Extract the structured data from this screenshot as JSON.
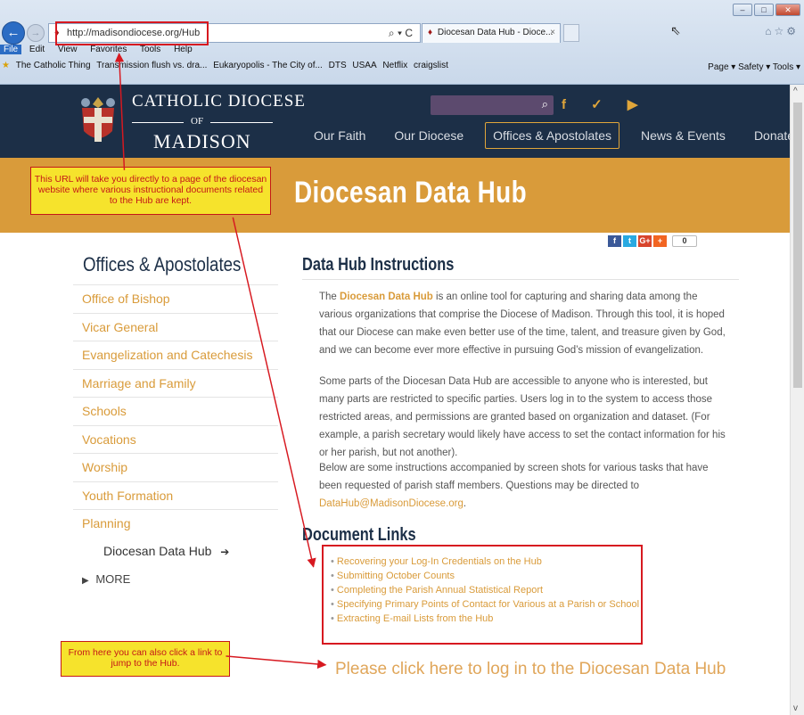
{
  "browser": {
    "url": "http://madisondiocese.org/Hub",
    "tab_title": "Diocesan Data Hub - Dioce...",
    "tab_close": "×",
    "menu": [
      "File",
      "Edit",
      "View",
      "Favorites",
      "Tools",
      "Help"
    ],
    "favorites": [
      "The Catholic Thing",
      "Transmission flush vs. dra...",
      "Eukaryopolis - The City of...",
      "DTS",
      "USAA",
      "Netflix",
      "craigslist"
    ],
    "toolbar_right": "Page ▾   Safety ▾   Tools ▾",
    "addr_controls": "⌕ ▾ C",
    "win_controls": [
      "–",
      "□",
      "✕"
    ]
  },
  "site": {
    "logo_line1": "CATHOLIC DIOCESE",
    "logo_of": "OF",
    "logo_line2": "MADISON",
    "nav": [
      "Our Faith",
      "Our Diocese",
      "Offices & Apostolates",
      "News & Events",
      "Donate"
    ],
    "social_icons": [
      "facebook-icon",
      "twitter-icon",
      "youtube-icon"
    ],
    "social_glyphs": "f ✓ ▶"
  },
  "banner": {
    "title": "Diocesan Data Hub"
  },
  "share": {
    "buttons": [
      "f",
      "t",
      "G+",
      "+"
    ],
    "count": "0"
  },
  "sidebar": {
    "title": "Offices & Apostolates",
    "items": [
      "Office of Bishop",
      "Vicar General",
      "Evangelization and Catechesis",
      "Marriage and Family",
      "Schools",
      "Vocations",
      "Worship",
      "Youth Formation",
      "Planning"
    ],
    "current": "Diocesan Data Hub",
    "current_icon": "➔",
    "more": "MORE"
  },
  "main": {
    "title": "Data Hub Instructions",
    "p1_lead": "Diocesan Data Hub",
    "p1_rest": " is an online tool for capturing and sharing data among the various organizations that comprise the Diocese of Madison. Through this tool, it is hoped that our Diocese can make even better use of the time, talent, and treasure given by God, and we can become ever more effective in pursuing God’s mission of evangelization.",
    "p1_the": "The ",
    "p2": "Some parts of the Diocesan Data Hub are accessible to anyone who is interested, but many parts are restricted to specific parties. Users log in to the system to access those restricted areas, and permissions are granted based on organization and dataset. (For example, a parish secretary would likely have access to set the contact information for his or her parish, but not another).",
    "p3": "Below are some instructions accompanied by screen shots for various tasks that have been requested of parish staff members. Questions may be directed to ",
    "p3_email": "DataHub@MadisonDiocese.org",
    "p3_end": ".",
    "doc_title": "Document Links",
    "doc_links": [
      "Recovering your Log-In Credentials on the Hub",
      "Submitting October Counts",
      "Completing the Parish Annual Statistical Report",
      "Specifying Primary Points of Contact for Various at a Parish or School",
      "Extracting E-mail Lists from the Hub"
    ],
    "login_link": "Please click here to log in to the Diocesan Data Hub"
  },
  "annotations": {
    "callout1": "This URL will take you directly to a page of the diocesan website where various instructional documents related to the Hub are kept.",
    "callout2": "From here you can also click a link to jump to the Hub."
  },
  "colors": {
    "navy": "#1c2f47",
    "gold": "#d99b3a",
    "annotation_red": "#d71920",
    "annotation_yellow": "#f6e32c"
  }
}
